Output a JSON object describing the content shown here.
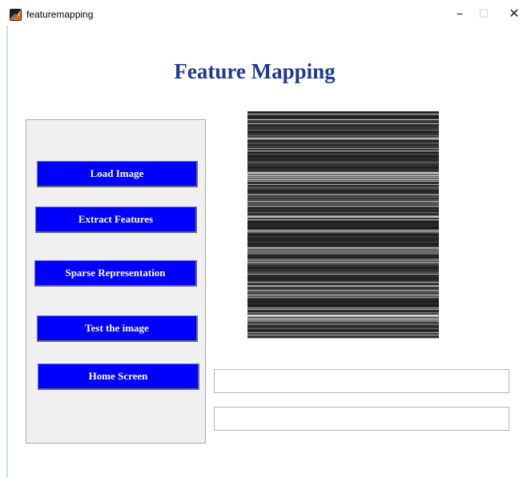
{
  "window": {
    "title": "featuremapping",
    "minimize_glyph": "–",
    "maximize_glyph": "□",
    "close_glyph": "✕",
    "icon": "matlab-icon"
  },
  "page": {
    "title": "Feature Mapping"
  },
  "buttons": {
    "load_image": "Load Image",
    "extract_features": "Extract Features",
    "sparse_representation": "Sparse Representation",
    "test_image": "Test the image",
    "home_screen": "Home Screen"
  },
  "image_display": {
    "content": "horizontal grayscale feature stripes"
  },
  "outputs": {
    "field_1": "",
    "field_2": ""
  },
  "colors": {
    "title": "#1f3a8f",
    "button_bg": "#0000fe",
    "button_text": "#ffffff",
    "panel_bg": "#f0f0f0"
  }
}
